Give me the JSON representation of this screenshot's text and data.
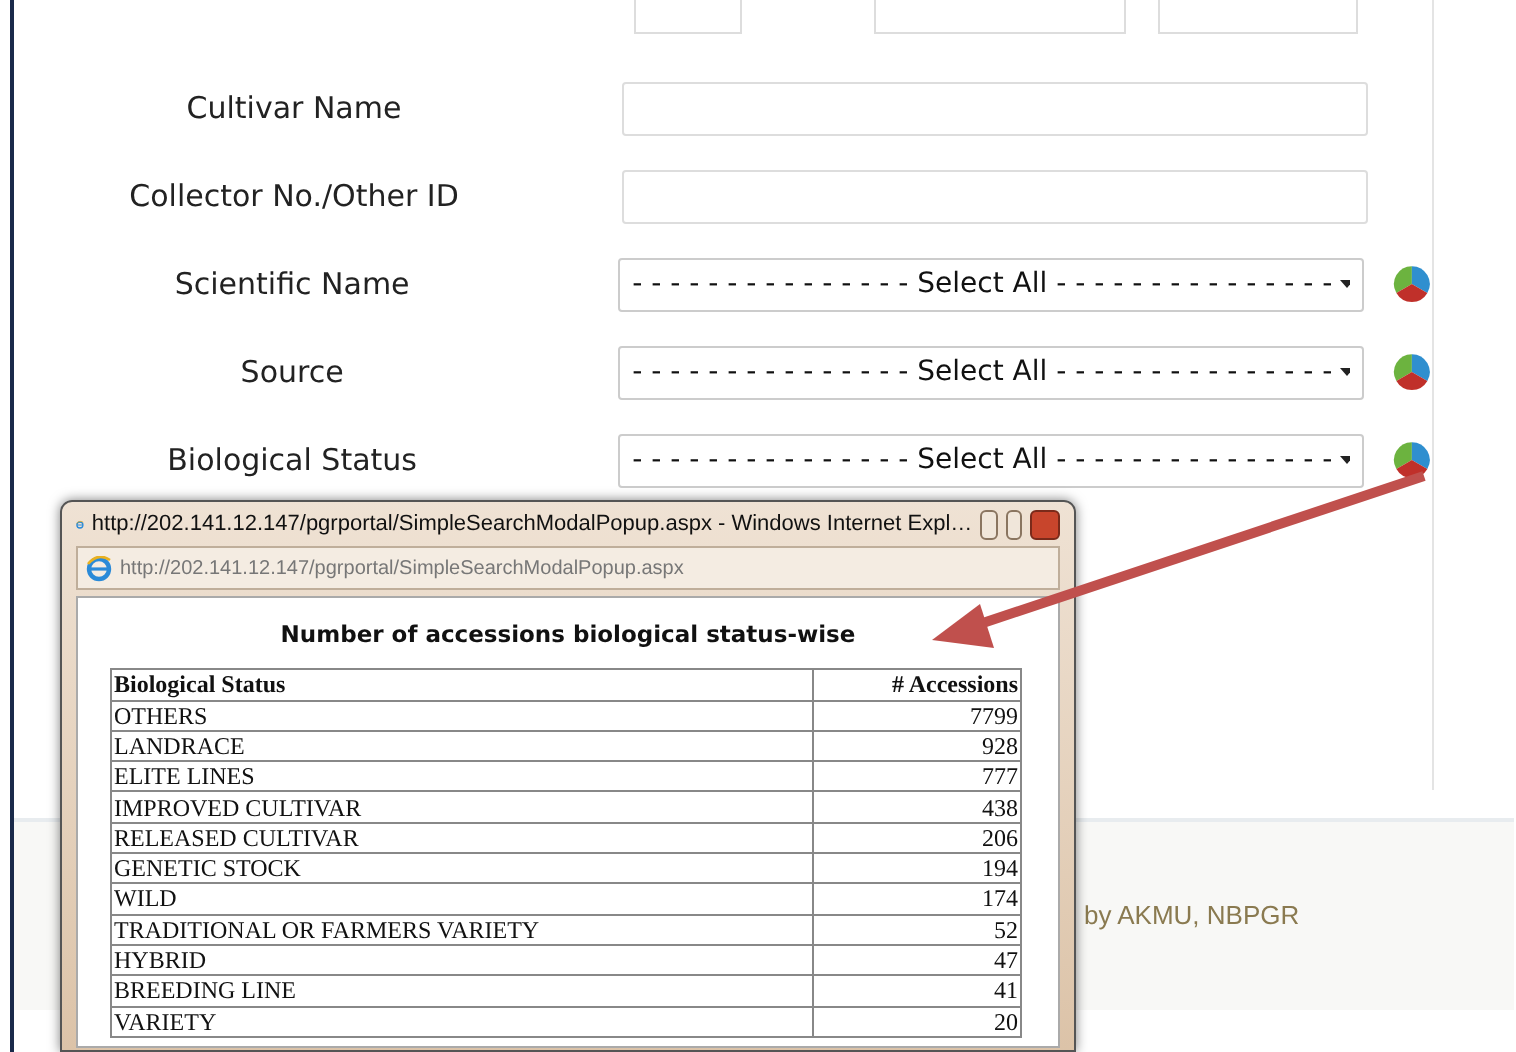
{
  "form": {
    "fields": [
      {
        "label": "Cultivar Name",
        "kind": "text"
      },
      {
        "label": "Collector No./Other ID",
        "kind": "text"
      },
      {
        "label": "Scientific Name",
        "kind": "select",
        "value": "- - - - - - - - - - - - - - - Select All - - - - - - - - - - - - - - -",
        "chart_icon": true
      },
      {
        "label": "Source",
        "kind": "select",
        "value": "- - - - - - - - - - - - - - - Select All - - - - - - - - - - - - - - -",
        "chart_icon": true
      },
      {
        "label": "Biological Status",
        "kind": "select",
        "value": "- - - - - - - - - - - - - - - Select All - - - - - - - - - - - - - - -",
        "chart_icon": true
      }
    ]
  },
  "popup": {
    "title": "http://202.141.12.147/pgrportal/SimpleSearchModalPopup.aspx - Windows Internet Expl…",
    "address": "http://202.141.12.147/pgrportal/SimpleSearchModalPopup.aspx",
    "heading": "Number of accessions biological status-wise",
    "table": {
      "columns": [
        "Biological Status",
        "# Accessions"
      ],
      "rows": [
        [
          "OTHERS",
          "7799"
        ],
        [
          "LANDRACE",
          "928"
        ],
        [
          "ELITE LINES",
          "777"
        ],
        [
          "IMPROVED CULTIVAR",
          "438"
        ],
        [
          "RELEASED CULTIVAR",
          "206"
        ],
        [
          "GENETIC STOCK",
          "194"
        ],
        [
          "WILD",
          "174"
        ],
        [
          "TRADITIONAL OR FARMERS VARIETY",
          "52"
        ],
        [
          "HYBRID",
          "47"
        ],
        [
          "BREEDING LINE",
          "41"
        ],
        [
          "VARIETY",
          "20"
        ]
      ]
    }
  },
  "footer": {
    "text": "by AKMU, NBPGR"
  }
}
